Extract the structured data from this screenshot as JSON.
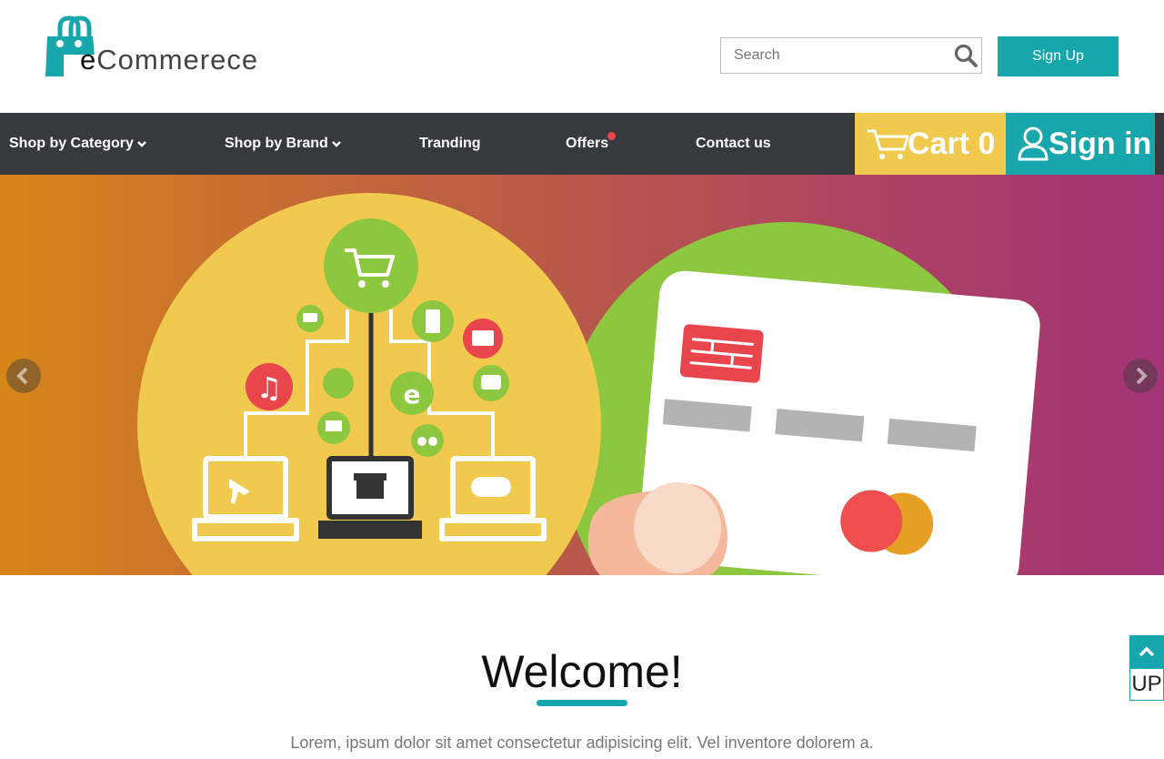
{
  "header": {
    "logo_prefix": "e",
    "logo_text": "Commerece",
    "search_placeholder": "Search",
    "signup_label": "Sign Up"
  },
  "nav": {
    "items": [
      {
        "label": "Shop by Category"
      },
      {
        "label": "Shop by Brand"
      },
      {
        "label": "Tranding"
      },
      {
        "label": "Offers"
      },
      {
        "label": "Contact us"
      }
    ],
    "cart_label": "Cart 0",
    "signin_label": "Sign in"
  },
  "colors": {
    "accent": "#17a6ab",
    "nav_bg": "#38393e",
    "cart_bg": "#f0c94e",
    "offers_dot": "#e8454d"
  },
  "welcome": {
    "title": "Welcome!",
    "text": "Lorem, ipsum dolor sit amet consectetur adipisicing elit. Vel inventore dolorem a."
  },
  "up_button": {
    "label": "UP"
  }
}
